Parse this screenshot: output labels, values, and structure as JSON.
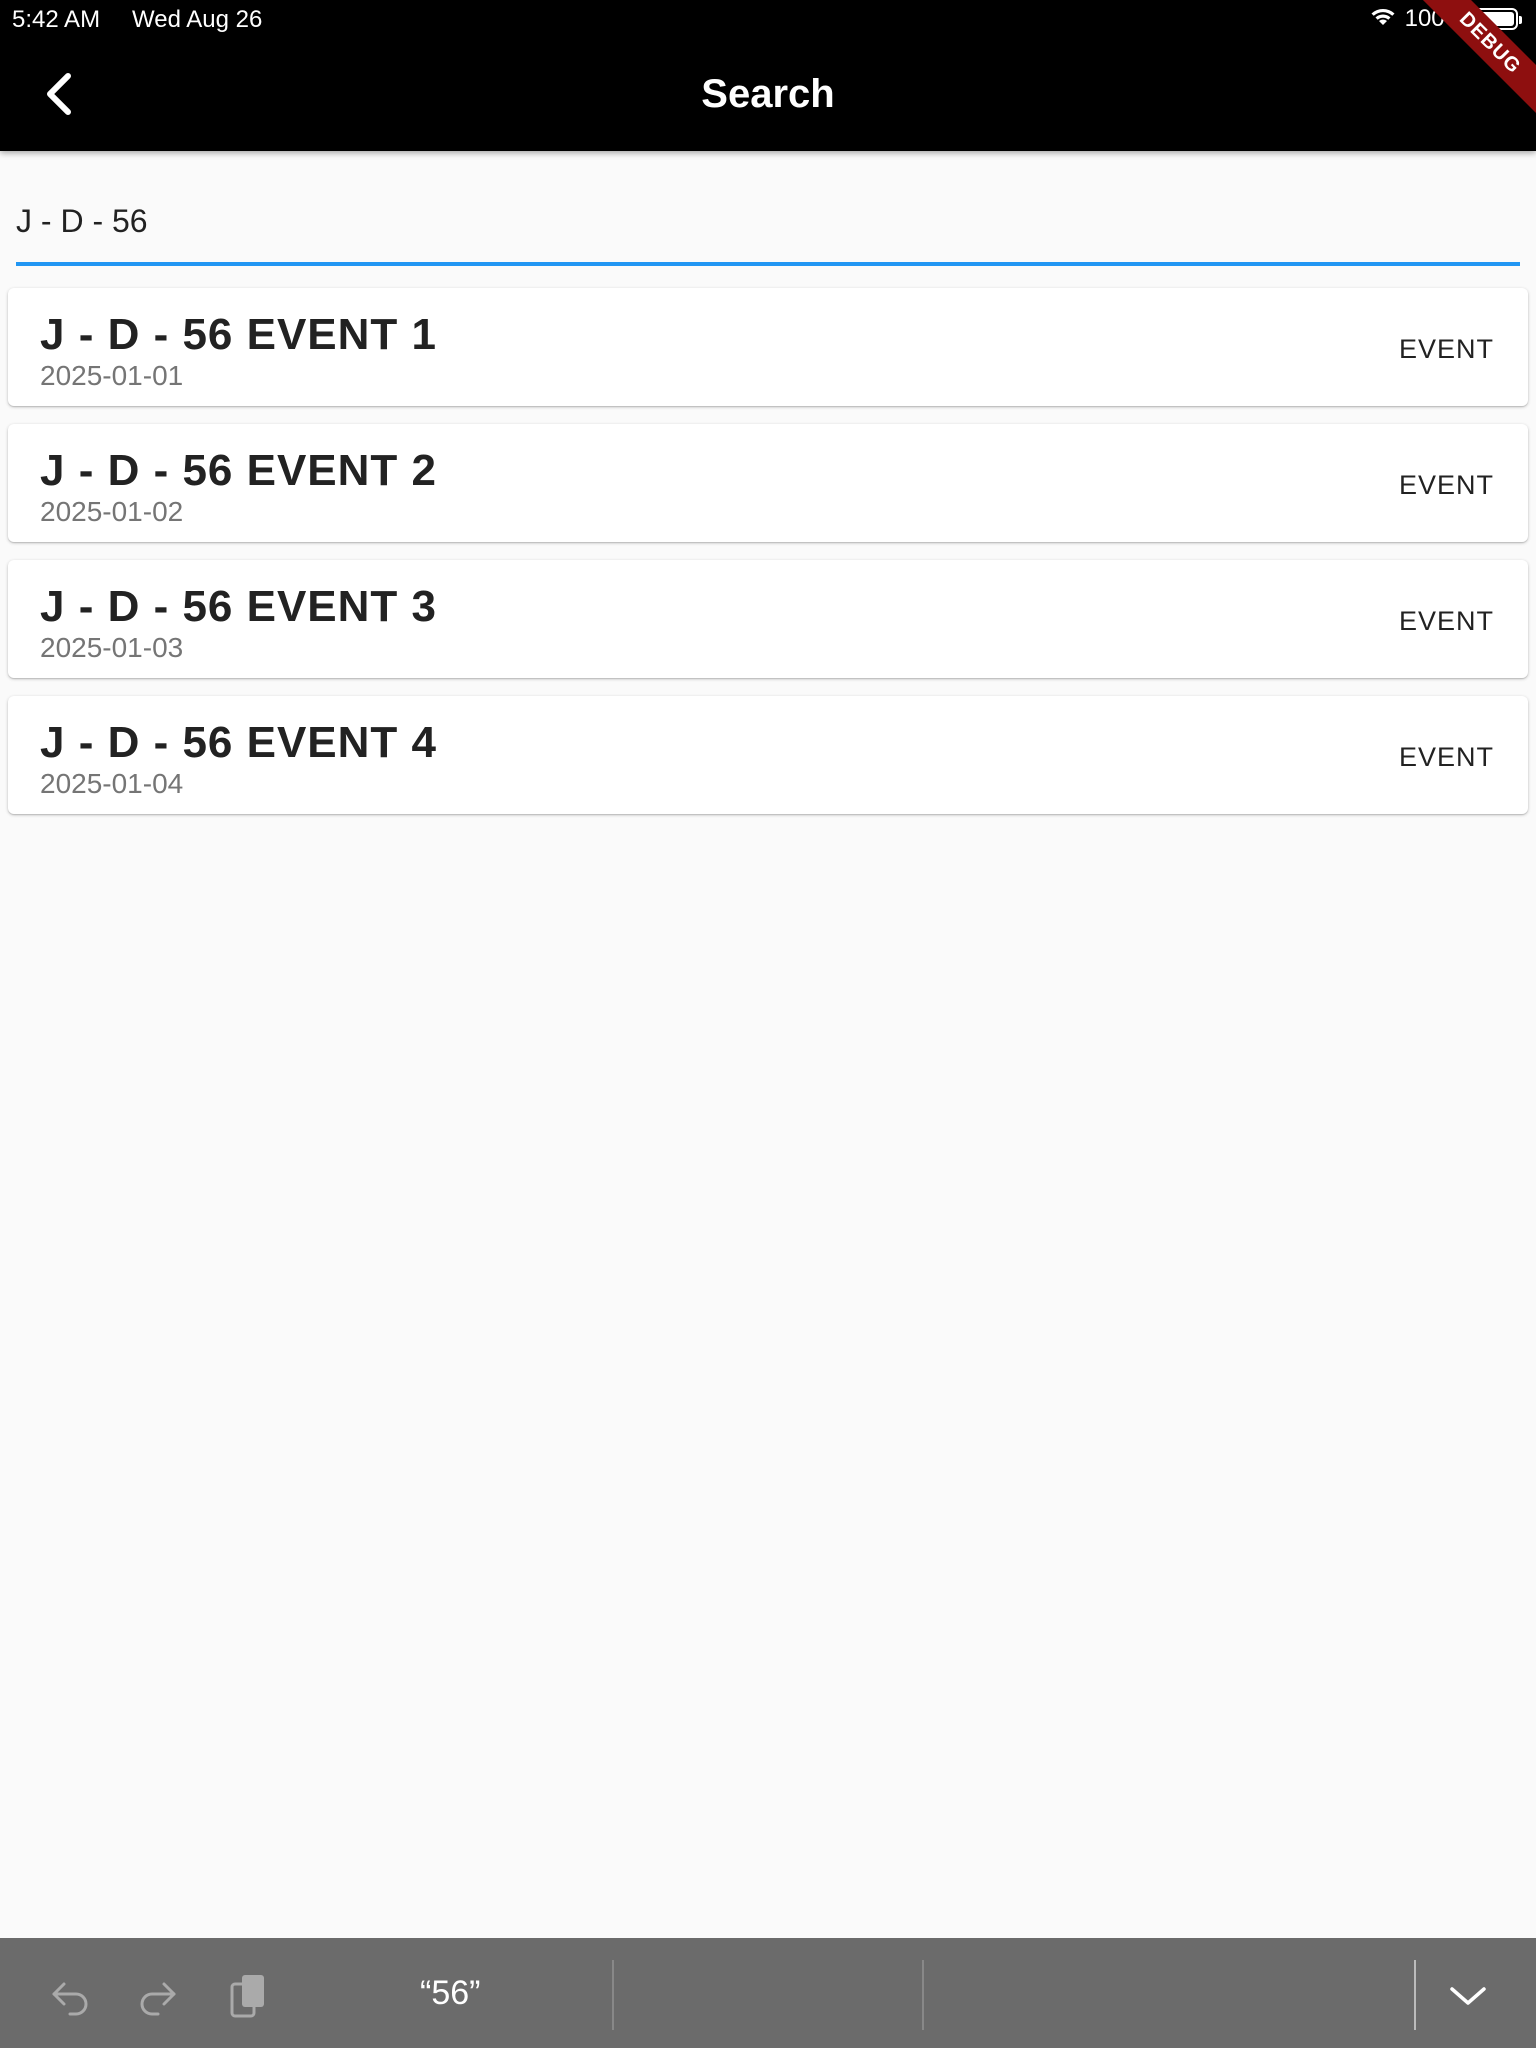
{
  "status_bar": {
    "time": "5:42 AM",
    "date": "Wed Aug 26",
    "battery": "100%",
    "wifi_icon": "wifi-icon"
  },
  "app_bar": {
    "title": "Search",
    "back_icon": "chevron-left-icon",
    "debug_banner": "DEBUG"
  },
  "search": {
    "value": "J - D - 56",
    "accent_color": "#2196f3"
  },
  "results": [
    {
      "title": "J - D - 56 EVENT 1",
      "date": "2025-01-01",
      "type": "EVENT"
    },
    {
      "title": "J - D - 56 EVENT 2",
      "date": "2025-01-02",
      "type": "EVENT"
    },
    {
      "title": "J - D - 56 EVENT 3",
      "date": "2025-01-03",
      "type": "EVENT"
    },
    {
      "title": "J - D - 56 EVENT 4",
      "date": "2025-01-04",
      "type": "EVENT"
    }
  ],
  "keyboard_bar": {
    "suggestion": "“56”",
    "undo_icon": "undo-icon",
    "redo_icon": "redo-icon",
    "paste_icon": "clipboard-icon",
    "dismiss_icon": "chevron-down-icon"
  }
}
